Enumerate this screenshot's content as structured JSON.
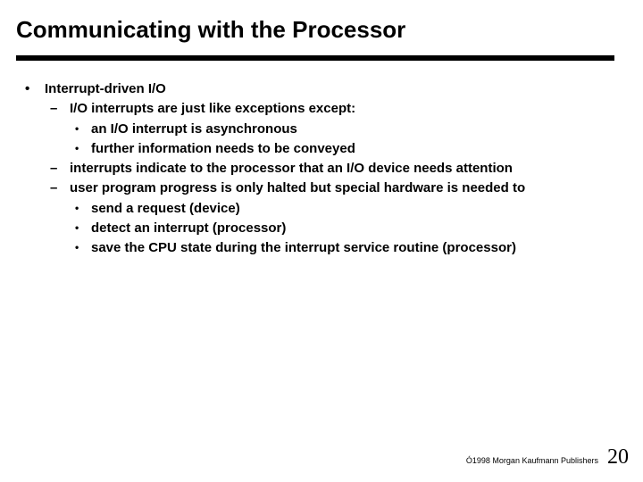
{
  "title": "Communicating with the Processor",
  "bullets": {
    "b1": "Interrupt-driven I/O",
    "b1_1": "I/O interrupts are just like exceptions except:",
    "b1_1_1": "an I/O interrupt is asynchronous",
    "b1_1_2": "further information needs to be conveyed",
    "b1_2": "interrupts indicate to the processor that an I/O device needs attention",
    "b1_3": "user program progress is only halted but special hardware is needed to",
    "b1_3_1": "send a request (device)",
    "b1_3_2": "detect an interrupt (processor)",
    "b1_3_3": "save the CPU state during the interrupt service routine (processor)"
  },
  "footer": {
    "copyright": "Ó1998 Morgan Kaufmann Publishers",
    "page": "20"
  }
}
